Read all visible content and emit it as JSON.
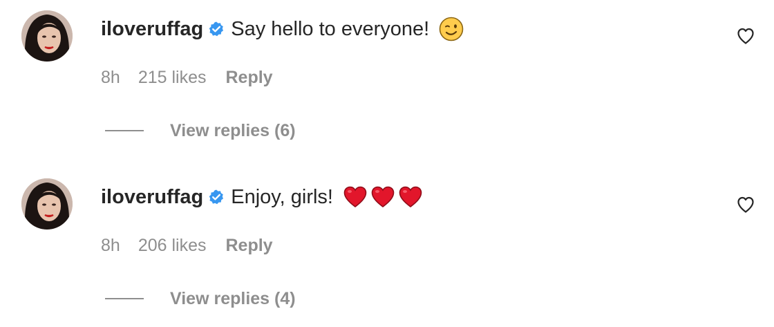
{
  "comments": [
    {
      "username": "iloveruffag",
      "text": "Say hello to everyone!",
      "emoji": [
        "wink-face"
      ],
      "time": "8h",
      "likes": "215 likes",
      "reply_label": "Reply",
      "view_replies": "View replies (6)"
    },
    {
      "username": "iloveruffag",
      "text": "Enjoy, girls!",
      "emoji": [
        "red-heart",
        "red-heart",
        "red-heart"
      ],
      "time": "8h",
      "likes": "206 likes",
      "reply_label": "Reply",
      "view_replies": "View replies (4)"
    }
  ],
  "icons": {
    "verified": "verified-badge-icon",
    "like": "heart-outline-icon"
  },
  "colors": {
    "text": "#262626",
    "secondary": "#8e8e8e",
    "verified": "#3897f0",
    "heart_emoji": "#e2162b"
  }
}
